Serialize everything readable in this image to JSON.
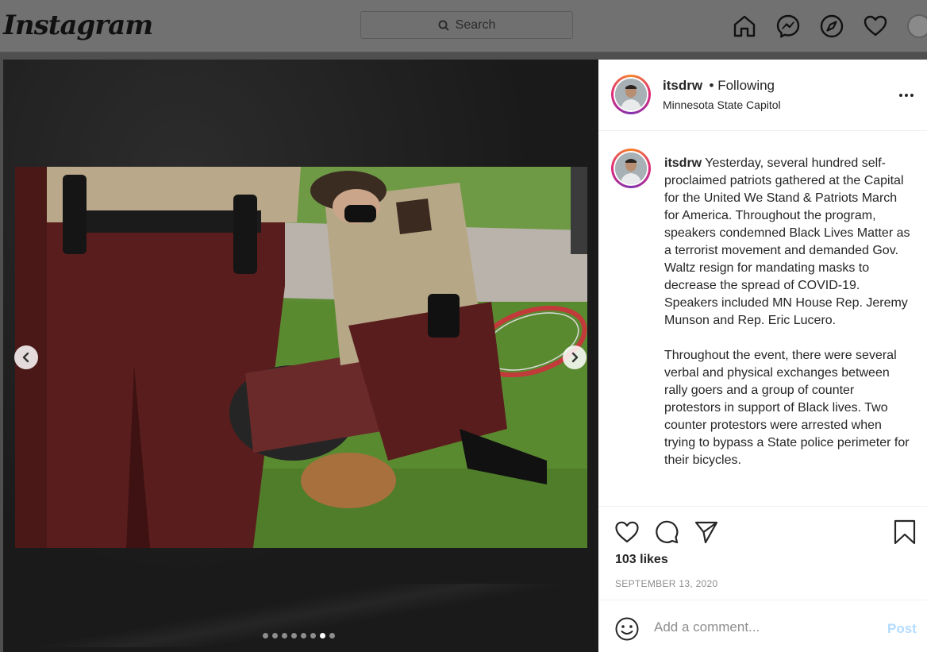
{
  "nav": {
    "logo": "Instagram",
    "search_placeholder": "Search",
    "icons": [
      "home-icon",
      "messenger-icon",
      "explore-icon",
      "heart-icon",
      "profile-avatar"
    ]
  },
  "carousel": {
    "dot_count": 8,
    "active_index": 6
  },
  "post": {
    "username": "itsdrw",
    "follow_status": "• Following",
    "location": "Minnesota State Capitol",
    "caption_username": "itsdrw",
    "caption_p1": "Yesterday, several hundred self-proclaimed patriots gathered at the Capital for the United We Stand & Patriots March for America. Throughout the program, speakers condemned Black Lives Matter as a terrorist movement and demanded Gov. Waltz resign for mandating masks to decrease the spread of COVID-19. Speakers included MN House Rep. Jeremy Munson and Rep. Eric Lucero.",
    "caption_p2": "Throughout the event, there were several verbal and physical exchanges between rally goers and a group of counter protestors in support of Black lives. Two counter protestors were arrested when trying to bypass a State police perimeter for their bicycles.",
    "likes": "103 likes",
    "date": "SEPTEMBER 13, 2020"
  },
  "comment": {
    "placeholder": "Add a comment...",
    "post_label": "Post"
  },
  "colors": {
    "post_button_disabled": "#b3dbff",
    "text_primary": "#262626",
    "text_secondary": "#8e8e8e"
  }
}
